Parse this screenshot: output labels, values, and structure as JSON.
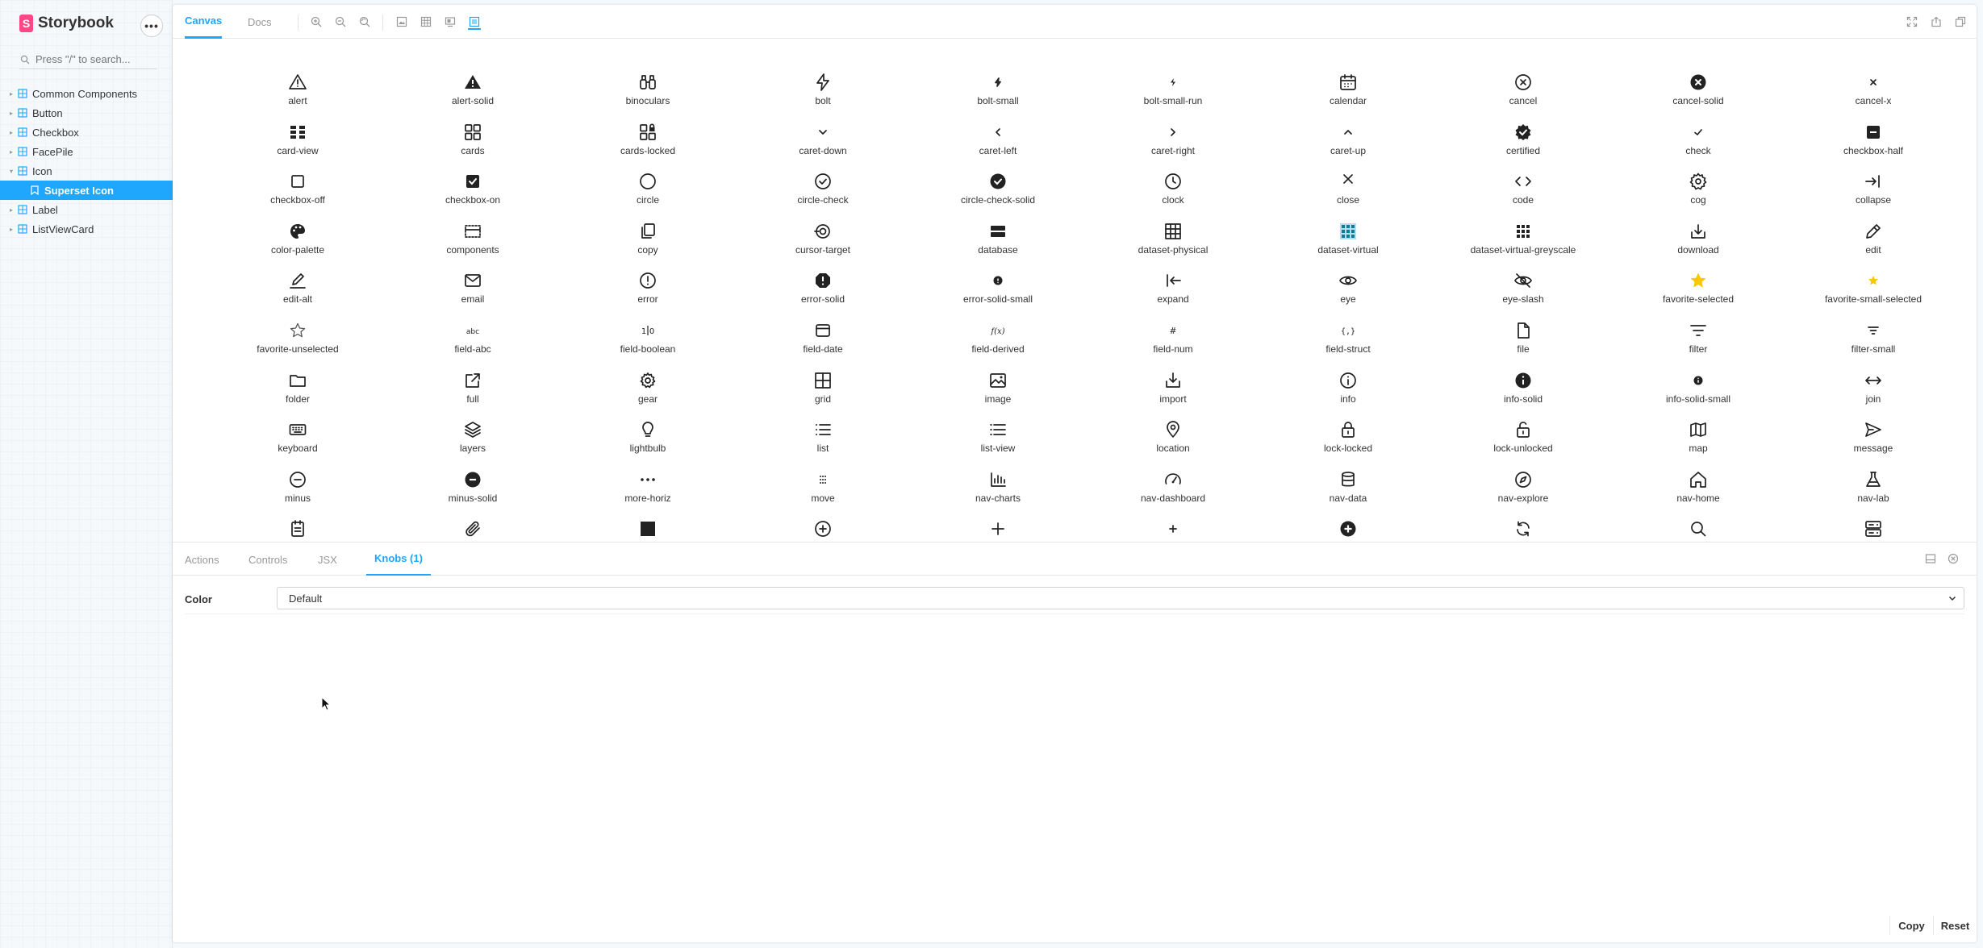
{
  "sidebar": {
    "brand": "Storybook",
    "logo_letter": "S",
    "menu_label": "•••",
    "search_placeholder": "Press \"/\" to search...",
    "items": [
      {
        "label": "Common Components",
        "type": "component"
      },
      {
        "label": "Button",
        "type": "component"
      },
      {
        "label": "Checkbox",
        "type": "component"
      },
      {
        "label": "FacePile",
        "type": "component"
      },
      {
        "label": "Icon",
        "type": "component",
        "expanded": true
      },
      {
        "label": "Superset Icon",
        "type": "story",
        "selected": true
      },
      {
        "label": "Label",
        "type": "component"
      },
      {
        "label": "ListViewCard",
        "type": "component"
      }
    ]
  },
  "toolbar": {
    "tabs": [
      "Canvas",
      "Docs"
    ],
    "active_tab": "Canvas",
    "icons": [
      "zoom-in-icon",
      "zoom-out-icon",
      "zoom-reset-icon",
      "background-icon",
      "grid-icon",
      "viewport-icon",
      "outline-icon",
      "fullscreen-icon",
      "share-icon",
      "copy-link-icon"
    ]
  },
  "icons": [
    "alert",
    "alert-solid",
    "binoculars",
    "bolt",
    "bolt-small",
    "bolt-small-run",
    "calendar",
    "cancel",
    "cancel-solid",
    "cancel-x",
    "card-view",
    "cards",
    "cards-locked",
    "caret-down",
    "caret-left",
    "caret-right",
    "caret-up",
    "certified",
    "check",
    "checkbox-half",
    "checkbox-off",
    "checkbox-on",
    "circle",
    "circle-check",
    "circle-check-solid",
    "clock",
    "close",
    "code",
    "cog",
    "collapse",
    "color-palette",
    "components",
    "copy",
    "cursor-target",
    "database",
    "dataset-physical",
    "dataset-virtual",
    "dataset-virtual-greyscale",
    "download",
    "edit",
    "edit-alt",
    "email",
    "error",
    "error-solid",
    "error-solid-small",
    "expand",
    "eye",
    "eye-slash",
    "favorite-selected",
    "favorite-small-selected",
    "favorite-unselected",
    "field-abc",
    "field-boolean",
    "field-date",
    "field-derived",
    "field-num",
    "field-struct",
    "file",
    "filter",
    "filter-small",
    "folder",
    "full",
    "gear",
    "grid",
    "image",
    "import",
    "info",
    "info-solid",
    "info-solid-small",
    "join",
    "keyboard",
    "layers",
    "lightbulb",
    "list",
    "list-view",
    "location",
    "lock-locked",
    "lock-unlocked",
    "map",
    "message",
    "minus",
    "minus-solid",
    "more-horiz",
    "move",
    "nav-charts",
    "nav-dashboard",
    "nav-data",
    "nav-explore",
    "nav-home",
    "nav-lab"
  ],
  "partial_row_icons": [
    "note-icon",
    "paperclip-icon",
    "square-icon",
    "plus-circle-icon",
    "plus-icon",
    "plus-small-icon",
    "plus-solid-icon",
    "refresh-icon",
    "search-icon",
    "server-icon"
  ],
  "colors": {
    "accent": "#1ea7fd",
    "brand": "#ff4785",
    "favorite": "#fbc700",
    "dataset_virtual": "#1fa7c9"
  },
  "addons": {
    "tabs": [
      "Actions",
      "Controls",
      "JSX",
      "Knobs (1)"
    ],
    "active_tab": "Knobs (1)"
  },
  "knobs": {
    "color_label": "Color",
    "color_value": "Default",
    "copy_label": "Copy",
    "reset_label": "Reset"
  }
}
